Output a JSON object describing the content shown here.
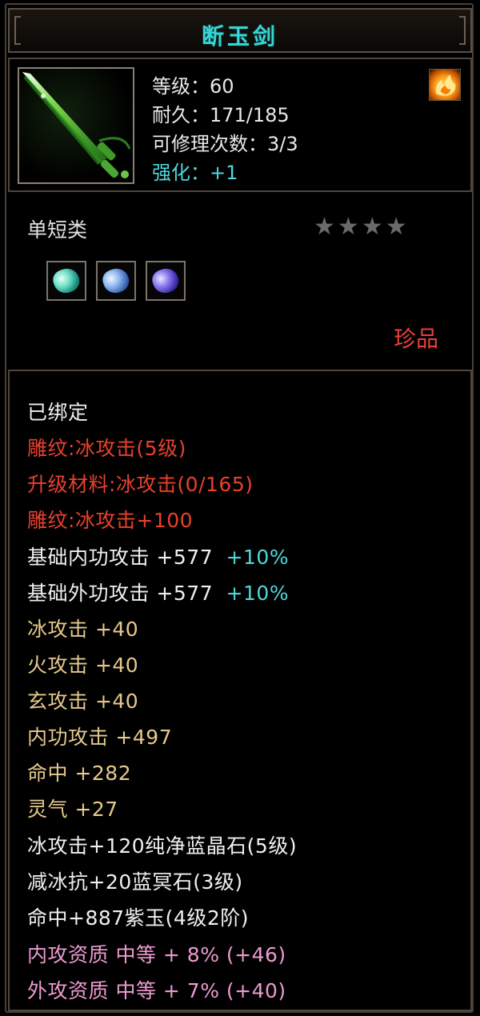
{
  "item": {
    "name": "断玉剑",
    "level_label": "等级：60",
    "durability_label": "耐久：171/185",
    "repair_label": "可修理次数：3/3",
    "enhance_label": "强化：+1",
    "category": "单短类",
    "stars_total": 4,
    "stars_filled": 0,
    "rarity": "珍品"
  },
  "icons": {
    "item": "jade-sword-icon",
    "badge": "flame-icon",
    "gems": [
      "teal-gem-icon",
      "blue-gem-icon",
      "purple-gem-icon"
    ]
  },
  "colors": {
    "title": "#37d6d4",
    "red": "#e8402e",
    "tan": "#e6c98c",
    "pink": "#ef9ad2",
    "teal": "#4fd8d8"
  },
  "attributes": {
    "bound": "已绑定",
    "engrave1": "雕纹:冰攻击(5级)",
    "upgrade_material": "升级材料:冰攻击(0/165)",
    "engrave2": "雕纹:冰攻击+100",
    "base_inner": {
      "label": "基础内功攻击  +577",
      "bonus": "+10%"
    },
    "base_outer": {
      "label": "基础外功攻击  +577",
      "bonus": "+10%"
    },
    "ice": "冰攻击  +40",
    "fire": "火攻击  +40",
    "mystic": "玄攻击  +40",
    "inner_attack": "内功攻击  +497",
    "hit": "命中  +282",
    "spirit": "灵气  +27",
    "gem1": "冰攻击+120纯净蓝晶石(5级)",
    "gem2": "减冰抗+20蓝冥石(3级)",
    "gem3": "命中+887紫玉(4级2阶)",
    "aptitude_inner": "内攻资质  中等  + 8% (+46)",
    "aptitude_outer": "外攻资质  中等  + 7% (+40)"
  }
}
